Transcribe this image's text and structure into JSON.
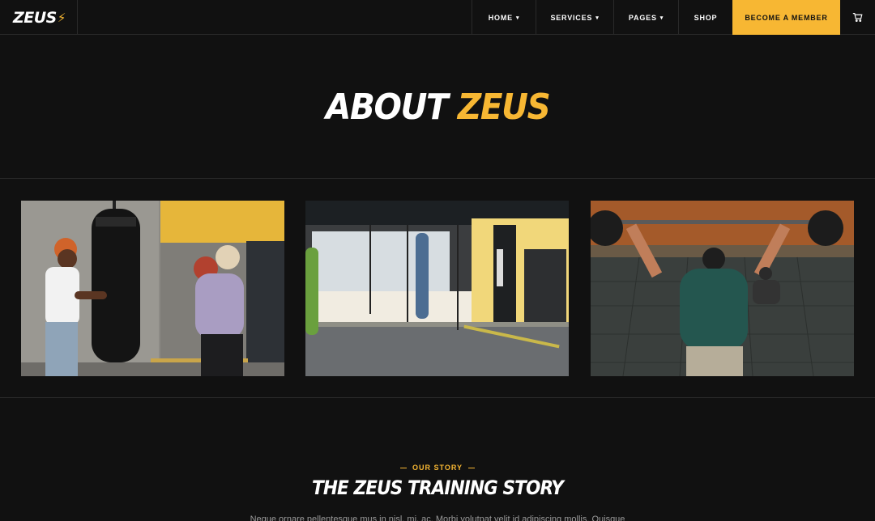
{
  "brand": {
    "logo_text": "ZEUS",
    "logo_mark": "⚡"
  },
  "nav": {
    "home": "HOME",
    "services": "SERVICES",
    "pages": "PAGES",
    "shop": "SHOP",
    "cta": "BECOME A MEMBER",
    "cart_icon": "cart-icon"
  },
  "hero": {
    "title_part1": "ABOUT",
    "title_part2": "ZEUS"
  },
  "gallery": {
    "images": [
      {
        "icon": "boxing-bag-photo"
      },
      {
        "icon": "gym-interior-photo"
      },
      {
        "icon": "weightlifting-photo"
      }
    ]
  },
  "story": {
    "eyebrow": "OUR STORY",
    "title": "THE ZEUS TRAINING STORY",
    "text": "Neque ornare pellentesque mus in nisl, mi, ac. Morbi volutpat velit id adipiscing mollis. Quisque"
  },
  "colors": {
    "accent": "#f7b733",
    "background": "#111111",
    "divider": "#2a2a2a"
  }
}
